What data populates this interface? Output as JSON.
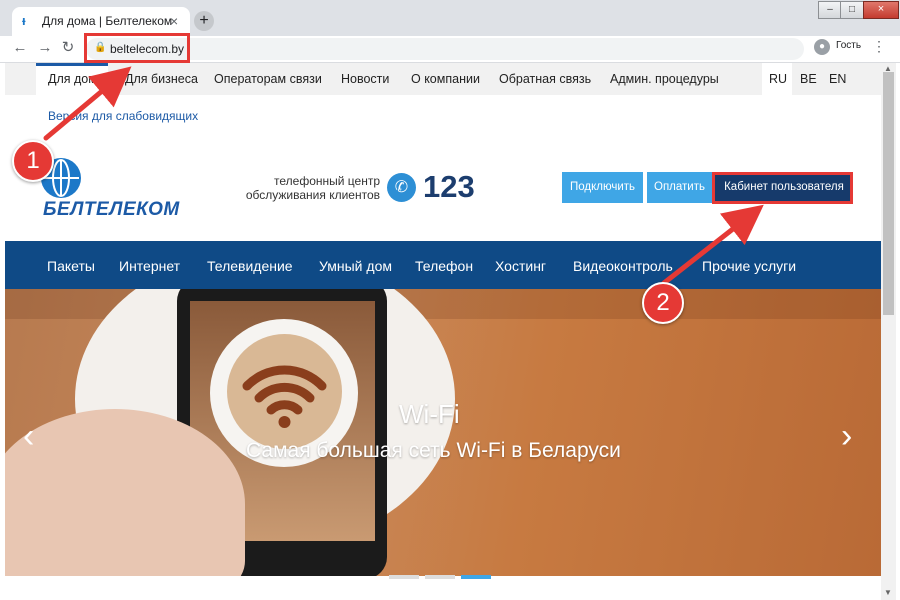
{
  "browser": {
    "tab_title": "Для дома | Белтелеком",
    "tab_close": "×",
    "new_tab": "+",
    "url": "beltelecom.by",
    "profile_label": "Гость",
    "window_controls": {
      "minimize": "–",
      "maximize": "□",
      "close": "×"
    }
  },
  "top_nav": {
    "items": [
      "Для дома",
      "Для бизнеса",
      "Операторам связи",
      "Новости",
      "О компании",
      "Обратная связь",
      "Админ. процедуры"
    ],
    "languages": [
      "RU",
      "BE",
      "EN"
    ],
    "active_language": "RU"
  },
  "visually_impaired_link": "Версия для слабовидящих",
  "logo_text": "БЕЛТЕЛЕКОМ",
  "call_center": {
    "line1": "телефонный центр",
    "line2": "обслуживания клиентов",
    "number": "123"
  },
  "buttons": {
    "connect": "Подключить",
    "pay": "Оплатить",
    "cabinet": "Кабинет пользователя"
  },
  "main_nav": [
    "Пакеты",
    "Интернет",
    "Телевидение",
    "Умный дом",
    "Телефон",
    "Хостинг",
    "Видеоконтроль",
    "Прочие услуги"
  ],
  "hero": {
    "title": "Wi-Fi",
    "subtitle": "Самая большая сеть Wi-Fi в Беларуси",
    "prev": "‹",
    "next": "›",
    "slide_count": 3,
    "active_slide": 3
  },
  "annotations": {
    "step1": "1",
    "step2": "2"
  },
  "colors": {
    "accent_blue": "#1c5aa6",
    "nav_blue": "#0f4a86",
    "button_blue": "#3fa6e6",
    "cabinet_dark": "#163a6b",
    "annotation_red": "#e53935"
  }
}
